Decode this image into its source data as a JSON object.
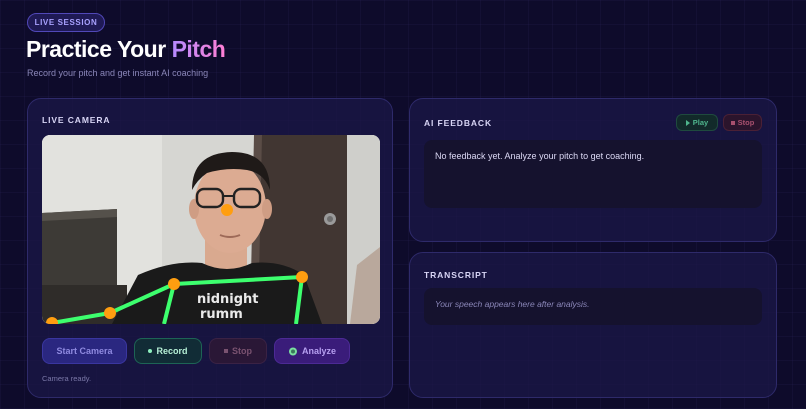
{
  "header": {
    "badge": "LIVE SESSION",
    "title_main": "Practice Your ",
    "title_accent": "Pitch",
    "subtitle": "Record your pitch and get instant AI coaching"
  },
  "camera": {
    "title": "LIVE CAMERA",
    "shirt_text_line1": "nidnight",
    "shirt_text_line2": "rumm",
    "buttons": {
      "start": "Start Camera",
      "record": "Record",
      "stop": "Stop",
      "analyze": "Analyze"
    },
    "status": "Camera ready."
  },
  "feedback": {
    "title": "AI FEEDBACK",
    "play_label": "Play",
    "stop_label": "Stop",
    "text": "No feedback yet. Analyze your pitch to get coaching."
  },
  "transcript": {
    "title": "TRANSCRIPT",
    "placeholder": "Your speech appears here after analysis."
  },
  "colors": {
    "background": "#0e0b2b",
    "panel": "#1c1748",
    "accent_gradient_start": "#b58bff",
    "accent_gradient_end": "#ff7fd4",
    "pose_line": "#3dff6e",
    "pose_joint": "#ff9e10",
    "record_green": "#8ef0bf",
    "stop_red": "#a8506e"
  },
  "icons": {
    "record": "record-dot-icon",
    "stop": "stop-square-icon",
    "analyze": "analyze-icon",
    "play": "play-icon"
  }
}
